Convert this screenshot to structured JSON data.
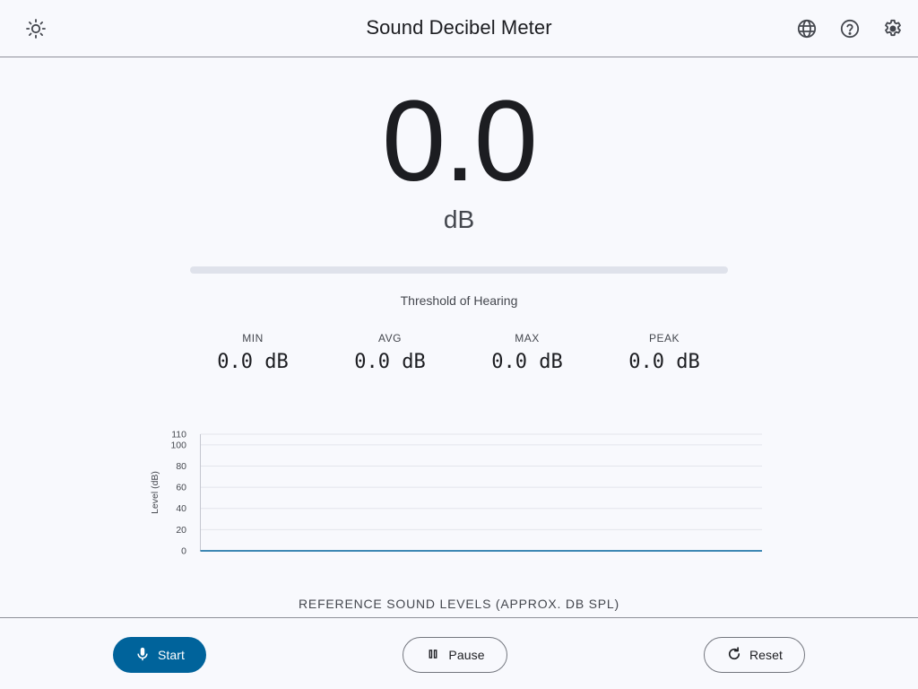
{
  "header": {
    "title": "Sound Decibel Meter",
    "left_icon": "brightness-icon",
    "right_icons": [
      "language-icon",
      "help-icon",
      "settings-icon"
    ]
  },
  "meter": {
    "value": "0.0",
    "unit": "dB",
    "level_fraction": 0,
    "description": "Threshold of Hearing"
  },
  "stats": [
    {
      "label": "MIN",
      "value": "0.0 dB"
    },
    {
      "label": "AVG",
      "value": "0.0 dB"
    },
    {
      "label": "MAX",
      "value": "0.0 dB"
    },
    {
      "label": "PEAK",
      "value": "0.0 dB"
    }
  ],
  "chart_data": {
    "type": "line",
    "ylabel": "Level (dB)",
    "xlabel": "",
    "yticks": [
      0,
      20,
      40,
      60,
      80,
      100,
      110
    ],
    "ylim": [
      0,
      110
    ],
    "grid": true,
    "series": [
      {
        "values": [
          0,
          0
        ]
      }
    ]
  },
  "reference": {
    "title": "REFERENCE SOUND LEVELS (APPROX. DB SPL)"
  },
  "footer": {
    "start_label": "Start",
    "pause_label": "Pause",
    "reset_label": "Reset"
  },
  "colors": {
    "primary": "#00639b",
    "background": "#f8f9fd",
    "outline": "#74777f"
  }
}
